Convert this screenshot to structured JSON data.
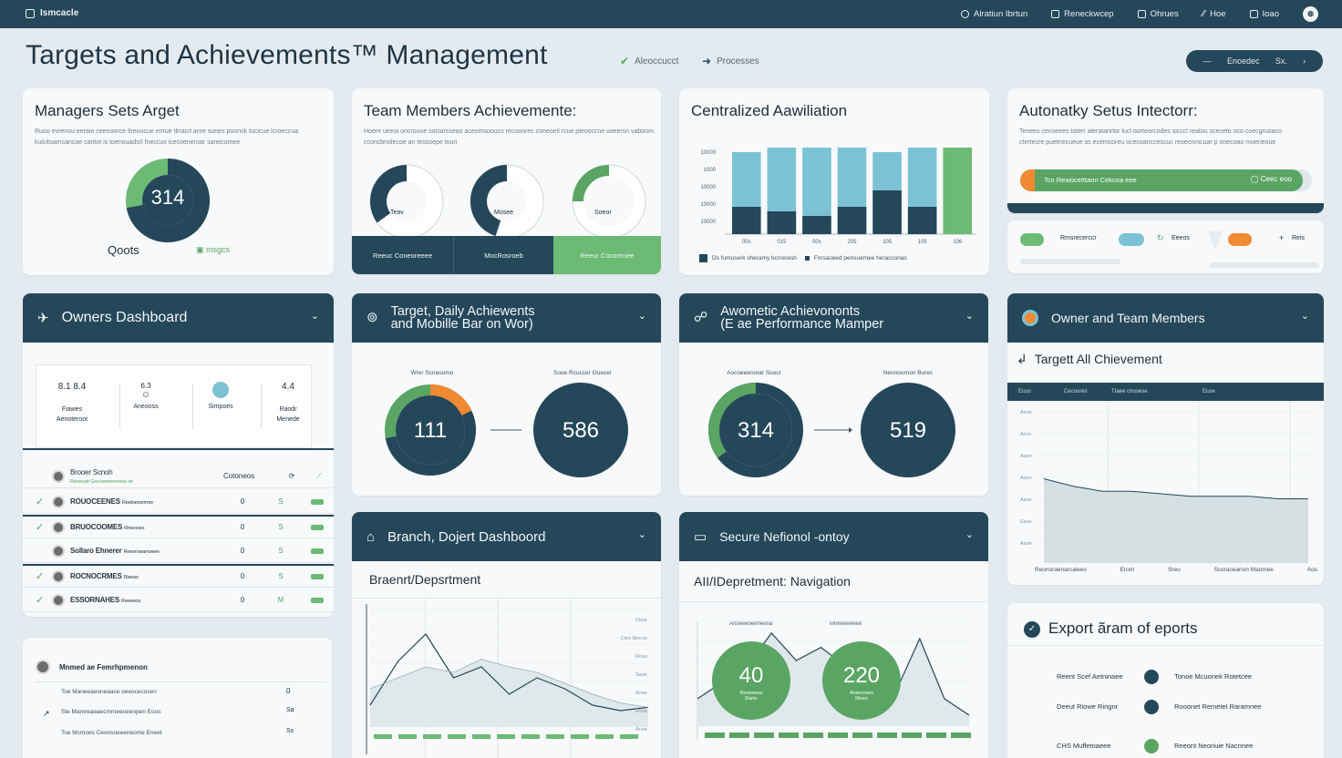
{
  "topbar": {
    "brand": "Ismcacle",
    "nav": [
      {
        "label": "Alratiun Ibrtun",
        "icon": "alert-icon"
      },
      {
        "label": "Reneckwcep",
        "icon": "grid-icon"
      },
      {
        "label": "Ohrues",
        "icon": "calendar-icon"
      },
      {
        "label": "Hoe",
        "icon": "chart-icon"
      },
      {
        "label": "Ioao",
        "icon": "calendar-icon"
      }
    ],
    "avatar": "⊗"
  },
  "page_title": "Targets and Achievements™ Management",
  "status": {
    "item1": "Aleoccucct",
    "item2": "Processes"
  },
  "header_pill": {
    "left": "Enoedec",
    "right": "Sx."
  },
  "colors": {
    "navy": "#25475a",
    "green": "#5aa563",
    "teal": "#7cc2d4",
    "orange": "#f08a33"
  },
  "cards": {
    "managers": {
      "title": "Managers Sets Arget",
      "text": "Ruoo evrenou eeraie ceeooorce tlreoucue enrue tlrracrl anre sunes poonsk tucicue lcroeccua kulcitoamcancae caritot is toenouadsrl fneccus icecoeneroar sareicomee",
      "ring_value": "314",
      "ring_fraction": 0.72,
      "caption": "Qoots",
      "badge": "msgcs"
    },
    "team": {
      "title": "Team Members Achievemente:",
      "text": "Hoere ueeoi oncrouoe sociarsseao aceomsooucs recooorec coneoeil rcue pteosccne voeersn vaboom cconcbnolecoe an teossepe toun",
      "gauges": [
        {
          "label": "Teav",
          "fraction": 0.35
        },
        {
          "label": "Mosee",
          "fraction": 0.45
        },
        {
          "label": "Soeor",
          "fraction": 0.25
        }
      ],
      "footer": [
        "Reeuc Coneoreeee",
        "MocRosroeb",
        "Reeur Cocorenee"
      ]
    },
    "centralized": {
      "title": "Centralized Aawiliation",
      "legend1": "Ds fumoserk sheramy bcnocesh",
      "legend2": "Fnrsaseed pensuemee heracconas",
      "chart_data": {
        "type": "bar",
        "categories": [
          "00s",
          "015",
          "00s",
          "205",
          "105",
          "105",
          "106"
        ],
        "ytick_labels": [
          "10000",
          "1000",
          "10000",
          "10000",
          "10000"
        ],
        "series": [
          {
            "name": "Ds fumoserk sheramy bcnocesh",
            "values": [
              30,
              25,
              20,
              30,
              48,
              30,
              0
            ]
          },
          {
            "name": "Fnrsaseed pensuemee heracconas",
            "values": [
              90,
              95,
              95,
              95,
              90,
              95,
              95
            ]
          }
        ]
      }
    },
    "automatic": {
      "title": "Autonatky Setus Intectorr:",
      "text": "Tenees cecoeees toterr aleratanrtor lucl oorteorcodes sicccl reatou sceceto oco coecgruoaco ctertecre puetnecueue ss ecemcoreu ocecoanccescuc reoecnmcuar p onecoao moerieoue",
      "bar_left": "Tco Rewocetttaon Cekcoa eee",
      "bar_right": "Ceec eoo",
      "progress": 0.97,
      "chips": [
        "Rmsrecerccr",
        "Eeeos",
        "Reis"
      ],
      "plus": "+"
    },
    "owners": {
      "title": "Owners Dashboard",
      "stats": [
        {
          "value": "8.1 8.4",
          "label1": "Fiawes",
          "label2": "Aenoteroot"
        },
        {
          "value": "6.3",
          "label1": "Aneooss",
          "label2": ""
        },
        {
          "value": "",
          "label1": "Simpoes",
          "label2": ""
        },
        {
          "value": "4.4",
          "label1": "Raodr",
          "label2": "Menede"
        }
      ],
      "table_header": {
        "name": "Brooer Scnoh",
        "sub": "Reneuotr Gocoenonomnee oe",
        "col": "Cotoneos"
      },
      "rows": [
        {
          "check": "✓",
          "name": "ROUOCEENES",
          "sub": "Reetoeesrrmre",
          "v1": "0",
          "v2": "S"
        },
        {
          "check": "✓",
          "name": "BRUOCOOMES",
          "sub": "Rmeooes",
          "v1": "0",
          "v2": "S"
        },
        {
          "check": "",
          "name": "Sollaro Ehnerer",
          "sub": "Reeorowamoeee",
          "v1": "0",
          "v2": "S"
        },
        {
          "check": "✓",
          "name": "ROCNOCRMES",
          "sub": "Riseao",
          "v1": "0",
          "v2": "S"
        },
        {
          "check": "✓",
          "name": "ESSORNAHES",
          "sub": "Reeeeoa",
          "v1": "0",
          "v2": "M"
        }
      ]
    },
    "target_daily": {
      "title1": "Target, Daily Achiewents",
      "title2": "and Mobille Bar on Wor)",
      "label1": "Wrer Scneoumo",
      "label2": "Sooe Rcuccer Ouecer",
      "value1": "111",
      "value2": "586",
      "fraction1": 0.72,
      "fraction1_orange": 0.18
    },
    "automatic_perf": {
      "title1": "Awometic Achievononts",
      "title2": "(E ae Performance Mamper",
      "label1": "Aocoeeeronar Soocr",
      "label2": "Neonoornon Burec",
      "value1": "314",
      "value2": "519",
      "fraction1": 0.35
    },
    "owner_team": {
      "title": "Owner and Team Members",
      "subtitle": "Targett All Chievement",
      "columns": [
        "Ecuo",
        "Cecoures",
        "Ttaee cnooese",
        "Ecoe"
      ],
      "yticks": [
        "Anos",
        "Acco",
        "Aaon",
        "Aacn",
        "Aaoe",
        "Eaoe",
        "Aaoe"
      ],
      "footer": [
        "Reonoraenarcaiees",
        "Erom",
        "Sreo",
        "Sceracearion Maomee",
        "Aos"
      ],
      "chart_data": {
        "type": "area",
        "x": [
          0,
          1,
          2,
          3,
          4,
          5,
          6,
          7,
          8,
          9
        ],
        "series": [
          {
            "name": "",
            "values": [
              30,
              27,
              25,
              25,
              24,
              23,
              23,
              23,
              22,
              22
            ]
          }
        ]
      }
    },
    "branch": {
      "title": "Branch, Dojert Dashboord",
      "subtitle": "Braenrt/Depsrtment",
      "ylabels": [
        "Dooe",
        "Cleo Mocoe",
        "Roso",
        "Saoe",
        "Aooe",
        "Rooe",
        "Anoe"
      ],
      "chart_data": {
        "type": "line",
        "x": [
          0,
          1,
          2,
          3,
          4,
          5,
          6,
          7,
          8,
          9,
          10
        ],
        "series": [
          {
            "name": "",
            "values": [
              20,
              60,
              85,
              45,
              55,
              30,
              45,
              35,
              20,
              15,
              18
            ]
          },
          {
            "name": "",
            "values": [
              35,
              45,
              55,
              50,
              62,
              55,
              50,
              40,
              30,
              22,
              18
            ]
          }
        ]
      }
    },
    "secure": {
      "title": "Secure Nefionol -ontoy",
      "subtitle": "AII/IDepretment: Navigation",
      "circle1": {
        "value": "40",
        "label1": "Noneeess",
        "label2": "Rarte"
      },
      "circle2": {
        "value": "220",
        "label1": "Anecnrsen",
        "label2": "Meen"
      },
      "top_label1": "Anoeeeoeeneena",
      "top_label2": "Mheeeeeeee",
      "chart_data": {
        "type": "line",
        "x": [
          0,
          1,
          2,
          3,
          4,
          5,
          6,
          7,
          8,
          9,
          10,
          11
        ],
        "series": [
          {
            "name": "",
            "values": [
              25,
              40,
              55,
              85,
              60,
              72,
              55,
              50,
              30,
              80,
              25,
              10
            ]
          }
        ]
      }
    },
    "export": {
      "title": "Export ãram of eports",
      "items": [
        {
          "left": "Reent Scef Aetninaee",
          "right": "Tonoe Mcuonek Rotetcee"
        },
        {
          "left": "Deeut Riowe Ringnr",
          "right": "Rooonet Remetel Raramnee"
        },
        {
          "left": "CHS Muffetoaeee",
          "right": "Reeont Neoriuie Nacnnee"
        }
      ]
    },
    "bottom_left": {
      "title": "Mnmed ae Femrhpmenon",
      "rows": [
        {
          "label": "Toe Maneeaeoneaace oeeocecosen",
          "value": "0"
        },
        {
          "label": "Ste Mamreaeaecmmeeoeenpen Eoos",
          "value": "Sa"
        },
        {
          "label": "Toe Mcmoes Ceonsoeeeneome Eneet",
          "value": "Ss"
        }
      ]
    }
  }
}
